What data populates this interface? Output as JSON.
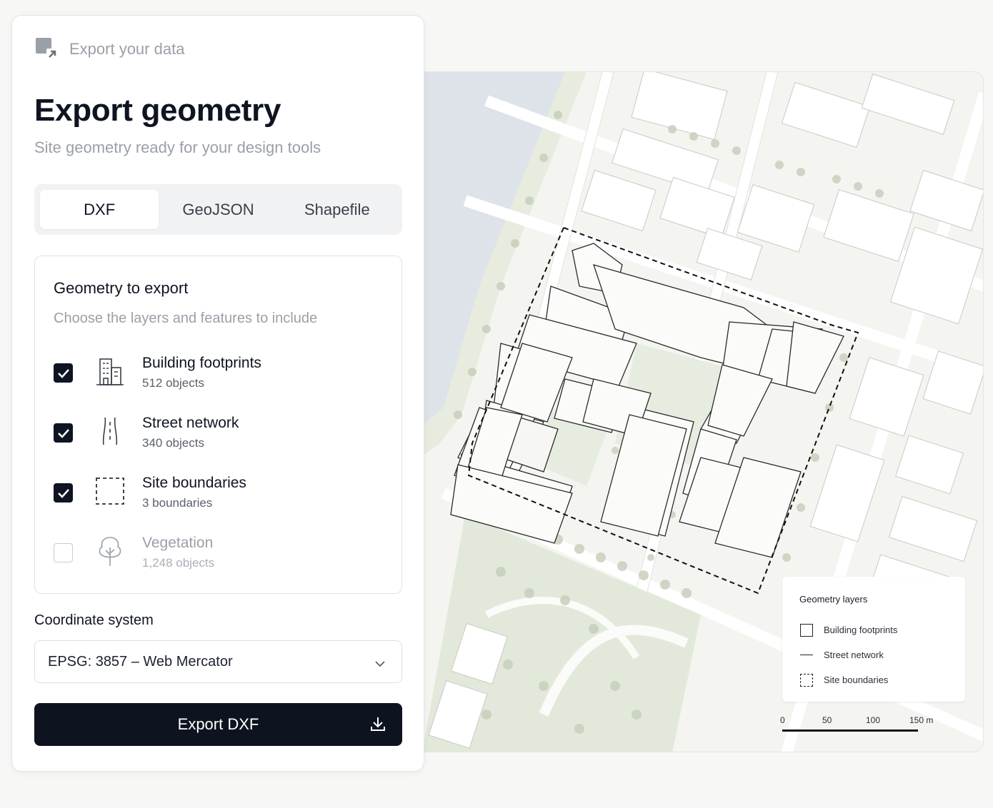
{
  "header": {
    "eyebrow": "Export your data",
    "title": "Export geometry",
    "subtitle": "Site geometry ready for your design tools"
  },
  "tabs": [
    {
      "label": "DXF",
      "active": true
    },
    {
      "label": "GeoJSON",
      "active": false
    },
    {
      "label": "Shapefile",
      "active": false
    }
  ],
  "geometry": {
    "title": "Geometry to export",
    "subtitle": "Choose the layers and features to include",
    "layers": [
      {
        "name": "Building footprints",
        "count": "512 objects",
        "checked": true,
        "icon": "building-icon"
      },
      {
        "name": "Street network",
        "count": "340 objects",
        "checked": true,
        "icon": "road-icon"
      },
      {
        "name": "Site boundaries",
        "count": "3 boundaries",
        "checked": true,
        "icon": "dashed-boundary-icon"
      },
      {
        "name": "Vegetation",
        "count": "1,248 objects",
        "checked": false,
        "icon": "tree-icon"
      }
    ]
  },
  "coordinate": {
    "label": "Coordinate system",
    "value": "EPSG: 3857 – Web Mercator"
  },
  "export_button": {
    "label": "Export DXF"
  },
  "legend": {
    "title": "Geometry layers",
    "items": [
      {
        "label": "Building footprints",
        "symbol": "outline-square"
      },
      {
        "label": "Street network",
        "symbol": "line"
      },
      {
        "label": "Site boundaries",
        "symbol": "dashed-square"
      }
    ]
  },
  "scale": {
    "ticks": [
      "0",
      "50",
      "100",
      "150 m"
    ]
  },
  "colors": {
    "accent": "#0e1320",
    "water": "#dde3e9",
    "vegetation": "#dfe6d6",
    "muted_text": "#9aa0a8"
  }
}
